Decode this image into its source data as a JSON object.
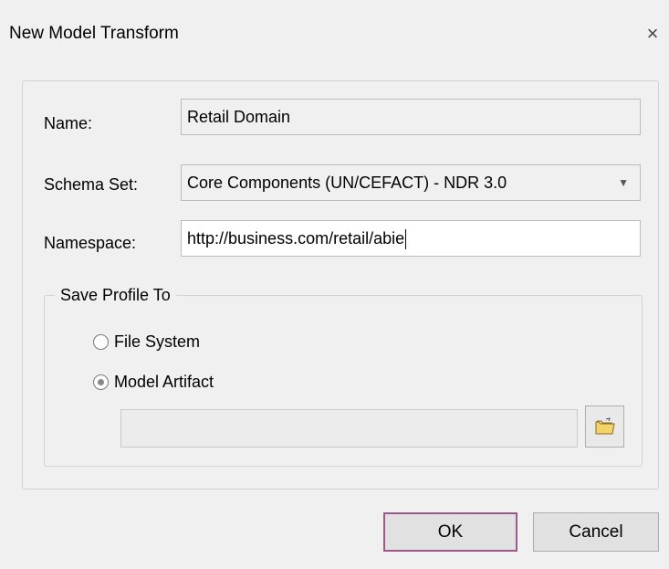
{
  "dialog": {
    "title": "New Model Transform",
    "close_glyph": "×"
  },
  "form": {
    "name_label": "Name:",
    "name_value": "Retail Domain",
    "schema_label": "Schema Set:",
    "schema_value": "Core Components (UN/CEFACT) - NDR 3.0",
    "namespace_label": "Namespace:",
    "namespace_value": "http://business.com/retail/abie"
  },
  "save_profile": {
    "legend": "Save Profile To",
    "options": [
      {
        "label": "File System",
        "selected": false
      },
      {
        "label": "Model Artifact",
        "selected": true
      }
    ],
    "path_value": ""
  },
  "buttons": {
    "ok": "OK",
    "cancel": "Cancel"
  },
  "icons": {
    "close": "close-icon",
    "dropdown": "chevron-down-icon",
    "browse": "folder-icon"
  },
  "colors": {
    "background": "#f0f0f0",
    "default_button_border": "#9b5a8a"
  }
}
